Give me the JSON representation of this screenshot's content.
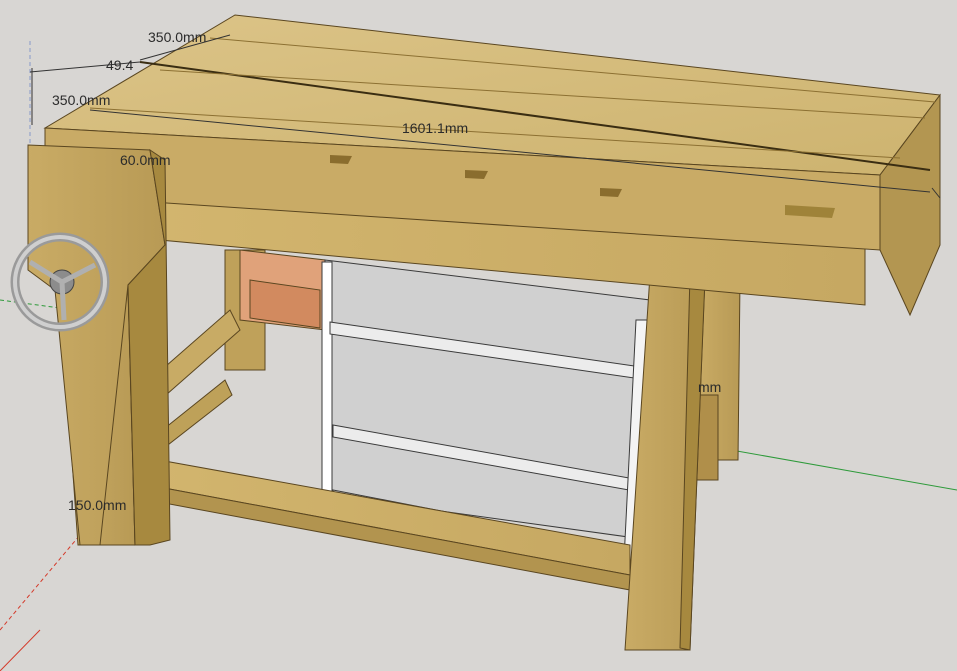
{
  "dimensions": {
    "top_width": "350.0mm",
    "offset": "49.4",
    "side_width": "350.0mm",
    "length": "1601.1mm",
    "thickness": "60.0mm",
    "right_partial": "mm",
    "leg_height": "150.0mm"
  },
  "colors": {
    "background": "#d8d6d3",
    "wood_top": "#d6bd7d",
    "wood_front": "#cdb06a",
    "wood_side": "#b79a55",
    "wood_dark": "#9d7e3d",
    "shelf": "#d4d4d4",
    "axis_red": "#d43a2a",
    "axis_green": "#2e9a3a"
  },
  "icons": {
    "handwheel": "vise-handwheel-icon"
  }
}
